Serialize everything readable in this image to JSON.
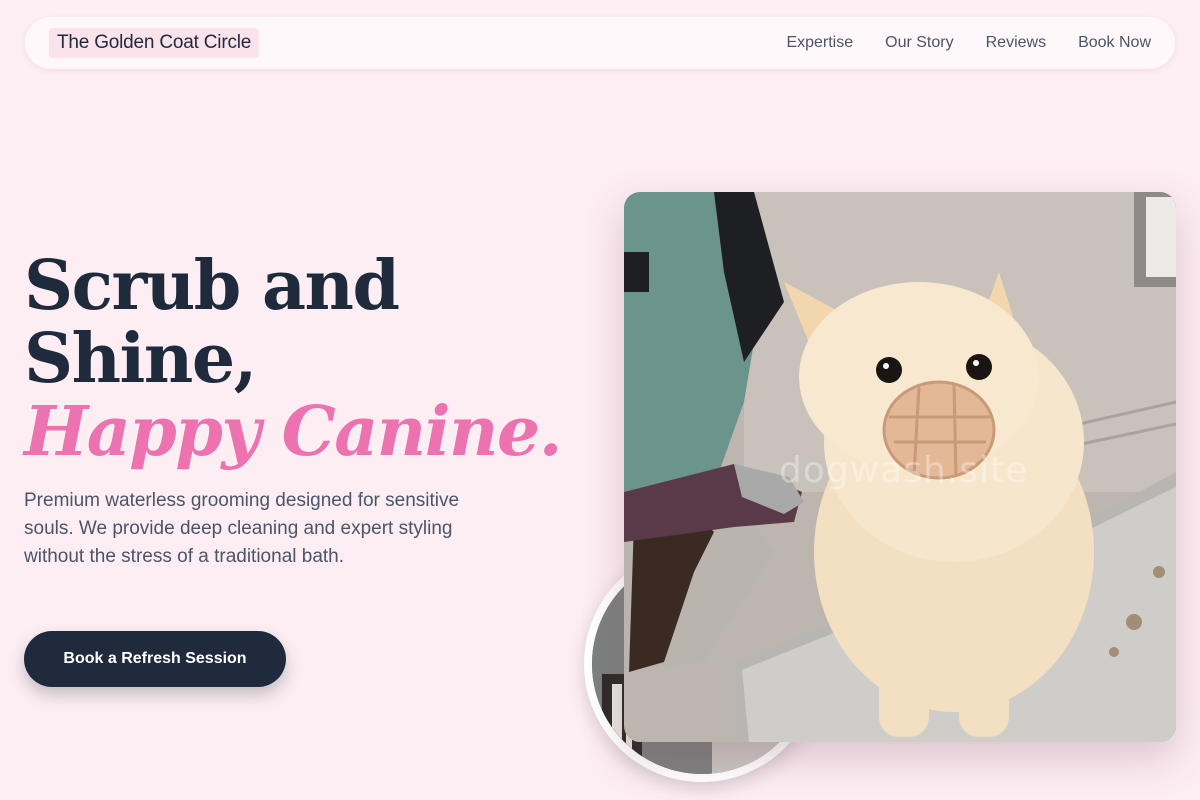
{
  "nav": {
    "brand": "The Golden Coat Circle",
    "links": [
      "Expertise",
      "Our Story",
      "Reviews",
      "Book Now"
    ]
  },
  "hero": {
    "title_line1": "Scrub and",
    "title_line2": "Shine,",
    "title_accent": "Happy Canine.",
    "subtitle": "Premium waterless grooming designed for sensitive souls. We provide deep cleaning and expert styling without the stress of a traditional bath.",
    "cta": "Book a Refresh Session"
  },
  "photo": {
    "watermark": "dogwash.site"
  },
  "colors": {
    "background": "#fdeef3",
    "navy": "#1f2a3d",
    "accent_pink": "#ec73b0"
  }
}
